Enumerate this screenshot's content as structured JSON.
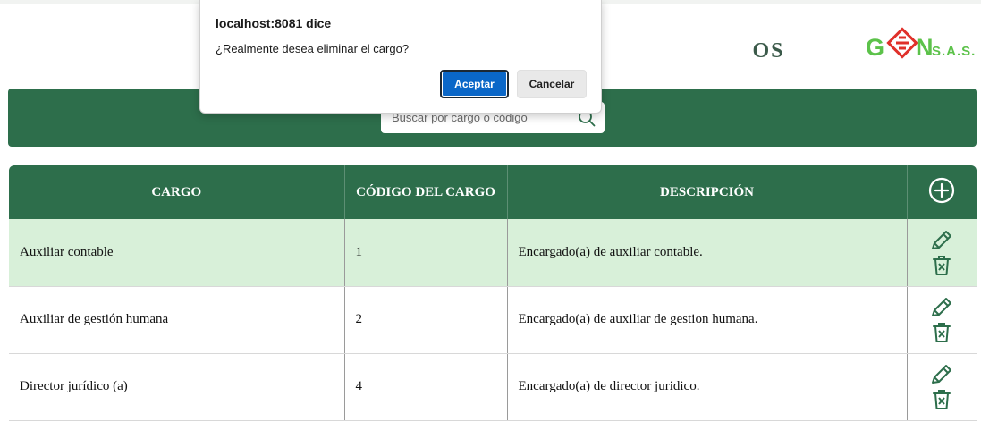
{
  "page": {
    "title_visible": "OS"
  },
  "logo": {
    "text_g": "G",
    "text_n": "N",
    "text_sas": "S.A.S."
  },
  "search": {
    "placeholder": "Buscar por cargo o código",
    "value": ""
  },
  "table": {
    "columns": [
      "CARGO",
      "CÓDIGO DEL CARGO",
      "DESCRIPCIÓN"
    ],
    "rows": [
      {
        "cargo": "Auxiliar contable",
        "codigo": "1",
        "descripcion": "Encargado(a) de auxiliar contable.",
        "selected": true
      },
      {
        "cargo": "Auxiliar de gestión humana",
        "codigo": "2",
        "descripcion": "Encargado(a) de auxiliar de gestion humana.",
        "selected": false
      },
      {
        "cargo": "Director jurídico (a)",
        "codigo": "4",
        "descripcion": "Encargado(a) de director juridico.",
        "selected": false
      }
    ]
  },
  "dialog": {
    "title": "localhost:8081 dice",
    "message": "¿Realmente desea eliminar el cargo?",
    "ok_label": "Aceptar",
    "cancel_label": "Cancelar"
  },
  "colors": {
    "brand_green": "#2d6e4b",
    "row_highlight": "#d8f0d9",
    "logo_green": "#5cc24a",
    "logo_red": "#e0302a",
    "primary_button": "#0a67c8"
  }
}
